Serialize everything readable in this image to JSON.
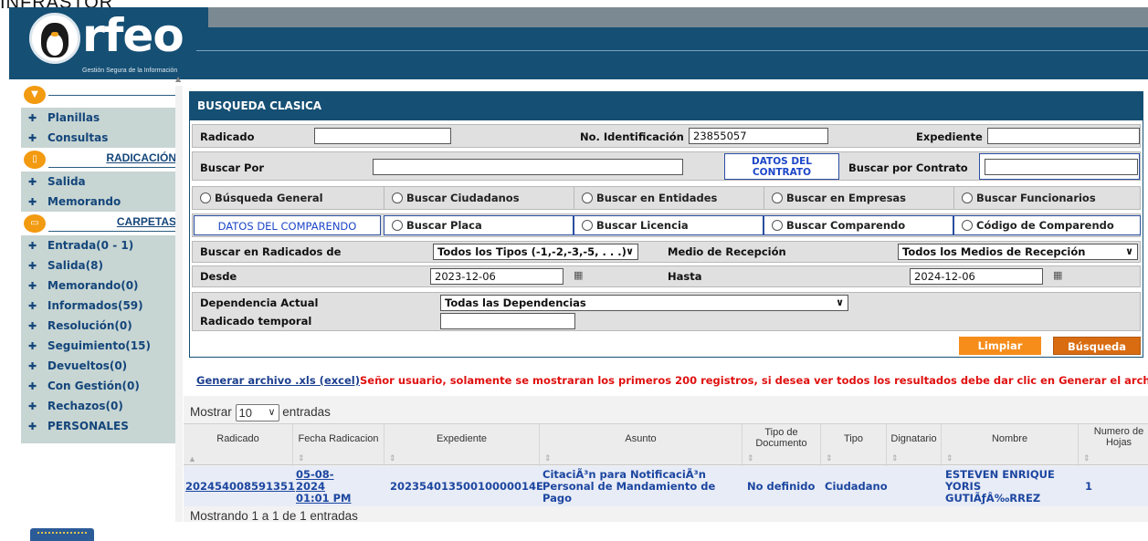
{
  "top_label": "INFRASTOR",
  "header": {
    "logo_text": "rfeo",
    "logo_subtitle": "Gestión Segura de la Información"
  },
  "sidebar": {
    "items_top": [
      "Planillas",
      "Consultas"
    ],
    "section_radicacion": "RADICACIÓN",
    "items_radicacion": [
      "Salida",
      "Memorando"
    ],
    "section_carpetas": "CARPETAS",
    "items_carpetas": [
      "Entrada(0 - 1)",
      "Salida(8)",
      "Memorando(0)",
      "Informados(59)",
      "Resolución(0)",
      "Seguimiento(15)",
      "Devueltos(0)",
      "Con Gestión(0)",
      "Rechazos(0)",
      "PERSONALES"
    ]
  },
  "form": {
    "title": "BUSQUEDA CLASICA",
    "radicado_label": "Radicado",
    "radicado_value": "",
    "no_identificacion_label": "No. Identificación",
    "no_identificacion_value": "23855057",
    "expediente_label": "Expediente",
    "expediente_value": "",
    "buscar_por_label": "Buscar Por",
    "buscar_por_value": "",
    "datos_contrato_label": "DATOS DEL CONTRATO",
    "buscar_por_contrato_label": "Buscar por Contrato",
    "buscar_por_contrato_value": "",
    "radios_row1": [
      "Búsqueda General",
      "Buscar Ciudadanos",
      "Buscar en Entidades",
      "Buscar en Empresas",
      "Buscar Funcionarios"
    ],
    "datos_comparendo_label": "DATOS DEL COMPARENDO",
    "radios_row2": [
      "Buscar Placa",
      "Buscar Licencia",
      "Buscar Comparendo",
      "Código de Comparendo"
    ],
    "buscar_radicados_label": "Buscar en Radicados de",
    "tipos_select": "Todos los Tipos (-1,-2,-3,-5, . . .)",
    "medio_recepcion_label": "Medio de Recepción",
    "medio_select": "Todos los Medios de Recepción",
    "desde_label": "Desde",
    "desde_value": "2023-12-06",
    "hasta_label": "Hasta",
    "hasta_value": "2024-12-06",
    "dependencia_label": "Dependencia Actual",
    "dependencia_select": "Todas las Dependencias",
    "radicado_temporal_label": "Radicado temporal",
    "radicado_temporal_value": "",
    "limpiar_label": "Limpiar",
    "busqueda_label": "Búsqueda"
  },
  "message": {
    "link": "Generar archivo .xls (excel)",
    "warning": "Señor usuario, solamente se mostraran los primeros 200 registros, si desea ver todos los resultados debe dar clic en Generar el archivo .xls"
  },
  "table": {
    "mostrar_label": "Mostrar",
    "page_size": "10",
    "entradas_label": "entradas",
    "columns": [
      "Radicado",
      "Fecha Radicacion",
      "Expediente",
      "Asunto",
      "Tipo de Documento",
      "Tipo",
      "Dignatario",
      "Nombre",
      "Numero de Hojas"
    ],
    "row": {
      "radicado": "202454008591351",
      "fecha": "05-08-2024 01:01 PM",
      "expediente": "20235401350010000014E",
      "asunto": "CitaciÃ³n para NotificaciÃ³n Personal de Mandamiento de Pago",
      "tipo_documento": "No definido",
      "tipo": "Ciudadano",
      "dignatario": "",
      "nombre": "ESTEVEN ENRIQUE YORIS GUTIÃƒÂ‰RREZ",
      "hojas": "1"
    },
    "footer": "Mostrando 1 a 1 de 1 entradas"
  },
  "colors": {
    "brand": "#154f74",
    "accent": "#f29a10",
    "link": "#1c46a0",
    "warning": "#e01010"
  }
}
